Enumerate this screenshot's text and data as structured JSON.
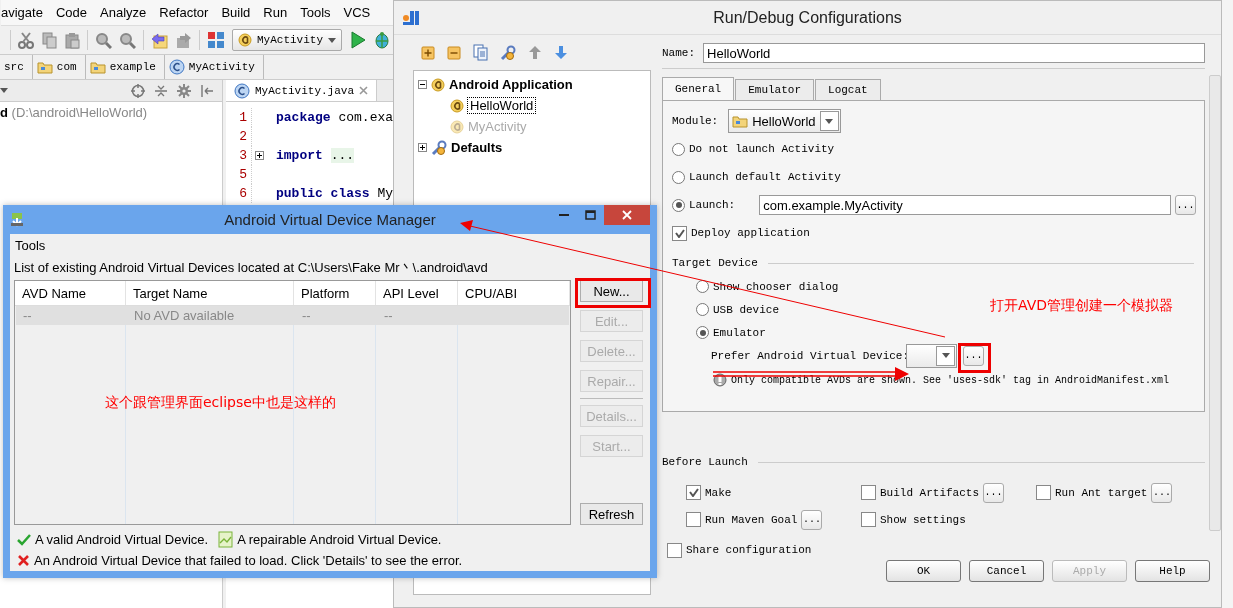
{
  "ide": {
    "menu": [
      {
        "label": "avigate"
      },
      {
        "label": "Code"
      },
      {
        "label": "Analyze"
      },
      {
        "label": "Refactor"
      },
      {
        "label": "Build"
      },
      {
        "label": "Run"
      },
      {
        "label": "Tools"
      },
      {
        "label": "VCS"
      }
    ],
    "run_config": "MyActivity",
    "breadcrumbs": [
      {
        "kind": "plain",
        "label": "src"
      },
      {
        "kind": "folder",
        "label": "com"
      },
      {
        "kind": "folder",
        "label": "example"
      },
      {
        "kind": "class",
        "label": "MyActivity"
      }
    ],
    "project_root": {
      "name": "d",
      "path": "(D:\\android\\HelloWorld)"
    },
    "editor_tab": "MyActivity.java",
    "code": [
      {
        "number": "1",
        "keyword": "package",
        "text": "com.exa"
      },
      {
        "number": "2"
      },
      {
        "number": "3",
        "keyword": "import",
        "folded": "..."
      },
      {
        "number": "5"
      },
      {
        "number": "6",
        "keyword": "public class",
        "text": "My"
      }
    ]
  },
  "run_dialog": {
    "title": "Run/Debug Configurations",
    "tree": [
      {
        "kind": "android",
        "label": "Android Application",
        "expanded": true,
        "children": [
          {
            "label": "HelloWorld",
            "selected": true,
            "dimmed": false
          },
          {
            "label": "MyActivity",
            "selected": false,
            "dimmed": true
          }
        ]
      },
      {
        "kind": "defaults",
        "label": "Defaults",
        "expanded": false
      }
    ],
    "name": {
      "label": "Name:",
      "value": "HelloWorld"
    },
    "tabs": [
      {
        "label": "General",
        "selected": true
      },
      {
        "label": "Emulator",
        "selected": false
      },
      {
        "label": "Logcat",
        "selected": false
      }
    ],
    "module": {
      "label": "Module:",
      "value": "HelloWorld"
    },
    "launch_options": [
      {
        "label": "Do not launch Activity",
        "selected": false
      },
      {
        "label": "Launch default Activity",
        "selected": false
      },
      {
        "label": "Launch:",
        "selected": true,
        "value": "com.example.MyActivity",
        "button": "..."
      }
    ],
    "deploy": {
      "label": "Deploy application",
      "checked": true
    },
    "target_device": {
      "title": "Target Device",
      "options": [
        {
          "label": "Show chooser dialog",
          "selected": false
        },
        {
          "label": "USB device",
          "selected": false
        },
        {
          "label": "Emulator",
          "selected": true
        }
      ],
      "prefer": {
        "label": "Prefer Android Virtual Device:",
        "button": "..."
      },
      "note": "Only compatible AVDs are shown. See 'uses-sdk' tag in AndroidManifest.xml"
    },
    "before_launch": {
      "title": "Before Launch",
      "options": [
        {
          "label": "Make",
          "checked": true
        },
        {
          "label": "Build Artifacts",
          "checked": false,
          "button": "..."
        },
        {
          "label": "Run Ant target",
          "checked": false,
          "button": "..."
        },
        {
          "label": "Run Maven Goal",
          "checked": false,
          "button": "..."
        },
        {
          "label": "Show settings",
          "checked": false
        }
      ]
    },
    "share": {
      "label": "Share configuration",
      "checked": false
    },
    "buttons": [
      {
        "label": "OK",
        "disabled": false
      },
      {
        "label": "Cancel",
        "disabled": false
      },
      {
        "label": "Apply",
        "disabled": true
      },
      {
        "label": "Help",
        "disabled": false
      }
    ]
  },
  "avd_manager": {
    "title": "Android Virtual Device Manager",
    "menu": [
      "Tools"
    ],
    "description": "List of existing Android Virtual Devices located at C:\\Users\\Fake Mr丶\\.android\\avd",
    "columns": [
      "AVD Name",
      "Target Name",
      "Platform",
      "API Level",
      "CPU/ABI"
    ],
    "rows": [
      [
        "--",
        "No AVD available",
        "--",
        "--"
      ]
    ],
    "action_groups": [
      [
        {
          "label": "New...",
          "disabled": false
        },
        {
          "label": "Edit...",
          "disabled": true
        },
        {
          "label": "Delete...",
          "disabled": true
        },
        {
          "label": "Repair...",
          "disabled": true
        }
      ],
      [
        {
          "label": "Details...",
          "disabled": true
        },
        {
          "label": "Start...",
          "disabled": true
        }
      ],
      [
        {
          "label": "Refresh",
          "disabled": false
        }
      ]
    ],
    "legend": [
      [
        {
          "kind": "valid",
          "text": "A valid Android Virtual Device."
        },
        {
          "kind": "repairable",
          "text": "A repairable Android Virtual Device."
        }
      ],
      [
        {
          "kind": "failed",
          "text": "An Android Virtual Device that failed to load. Click 'Details' to see the error."
        }
      ]
    ]
  },
  "annotations": [
    {
      "kind": "callout",
      "text": "打开AVD管理创建一个模拟器"
    },
    {
      "kind": "note",
      "text": "这个跟管理界面eclipse中也是这样的"
    }
  ]
}
